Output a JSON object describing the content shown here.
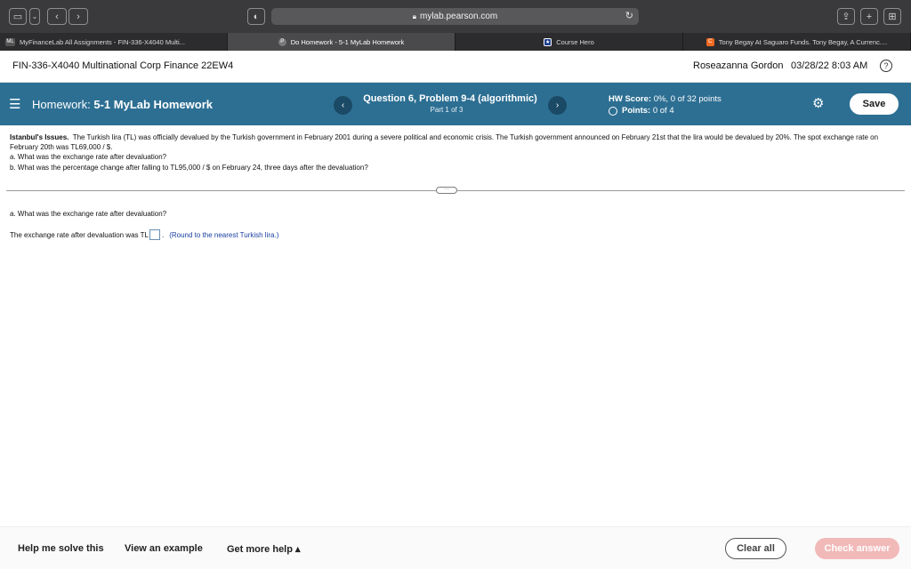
{
  "browser": {
    "url": "mylab.pearson.com",
    "tabs": [
      {
        "fav": "ML",
        "label": "MyFinanceLab All Assignments - FIN-336-X4040 Multi..."
      },
      {
        "fav": "P",
        "label": "Do Homework - 5-1 MyLab Homework"
      },
      {
        "fav": "★",
        "label": "Course Hero"
      },
      {
        "fav": "C",
        "label": "Tony Begay At Saguaro Funds. Tony Begay, A Currenc...."
      }
    ]
  },
  "course": {
    "title": "FIN-336-X4040 Multinational Corp Finance 22EW4",
    "user": "Roseazanna Gordon",
    "datetime": "03/28/22 8:03 AM",
    "help_glyph": "?"
  },
  "homework": {
    "prefix": "Homework:",
    "name": "5-1 MyLab Homework",
    "question_title": "Question 6, Problem 9-4 (algorithmic)",
    "part": "Part 1 of 3",
    "score_label": "HW Score:",
    "score_value": "0%, 0 of 32 points",
    "points_label": "Points:",
    "points_value": "0 of 4",
    "save_label": "Save",
    "prev_glyph": "‹",
    "next_glyph": "›"
  },
  "problem": {
    "heading": "Istanbul's Issues.",
    "body": "The Turkish lira (TL) was officially devalued by the Turkish government in February 2001 during a severe political and economic crisis. The Turkish government announced on February 21st that the lira would be devalued by 20%. The spot exchange rate on February 20th was TL69,000 / $.",
    "qa": "a. What was the exchange rate after devaluation?",
    "qb": "b. What was the percentage change after falling to TL95,000 / $ on February 24, three days after the devaluation?"
  },
  "answer": {
    "question": "a. What was the exchange rate after devaluation?",
    "prefix": "The exchange rate after devaluation was TL",
    "suffix": ".",
    "note": "(Round to the nearest Turkish lira.)"
  },
  "footer": {
    "help_solve": "Help me solve this",
    "view_example": "View an example",
    "more_help": "Get more help ▴",
    "clear_all": "Clear all",
    "check_answer": "Check answer"
  }
}
